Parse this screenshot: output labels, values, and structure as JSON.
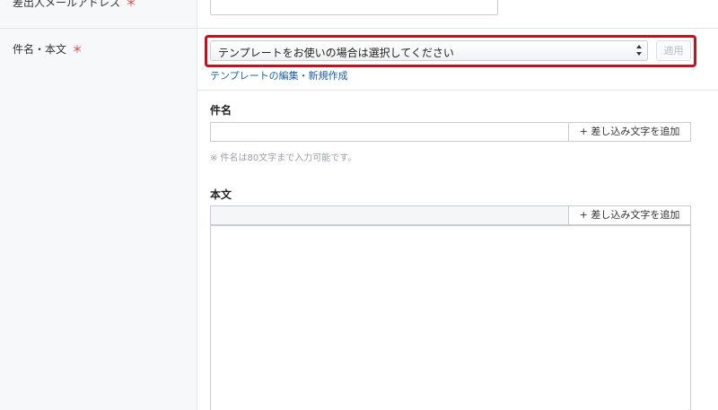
{
  "sender_email": {
    "label": "差出人メールアドレス",
    "required_mark": "＊",
    "value": ""
  },
  "subject_body": {
    "label": "件名・本文",
    "required_mark": "＊",
    "template_select": {
      "selected": "テンプレートをお使いの場合は選択してください"
    },
    "apply_label": "適用",
    "edit_link": "テンプレートの編集・新規作成"
  },
  "subject": {
    "title": "件名",
    "value": "",
    "insert_label": "+ 差し込み文字を追加",
    "hint": "※ 件名は80文字まで入力可能です。"
  },
  "body": {
    "title": "本文",
    "value": "",
    "insert_label": "+ 差し込み文字を追加"
  },
  "colors": {
    "highlight": "#c1121f",
    "required": "#e0383e",
    "link": "#1f5fa8"
  }
}
